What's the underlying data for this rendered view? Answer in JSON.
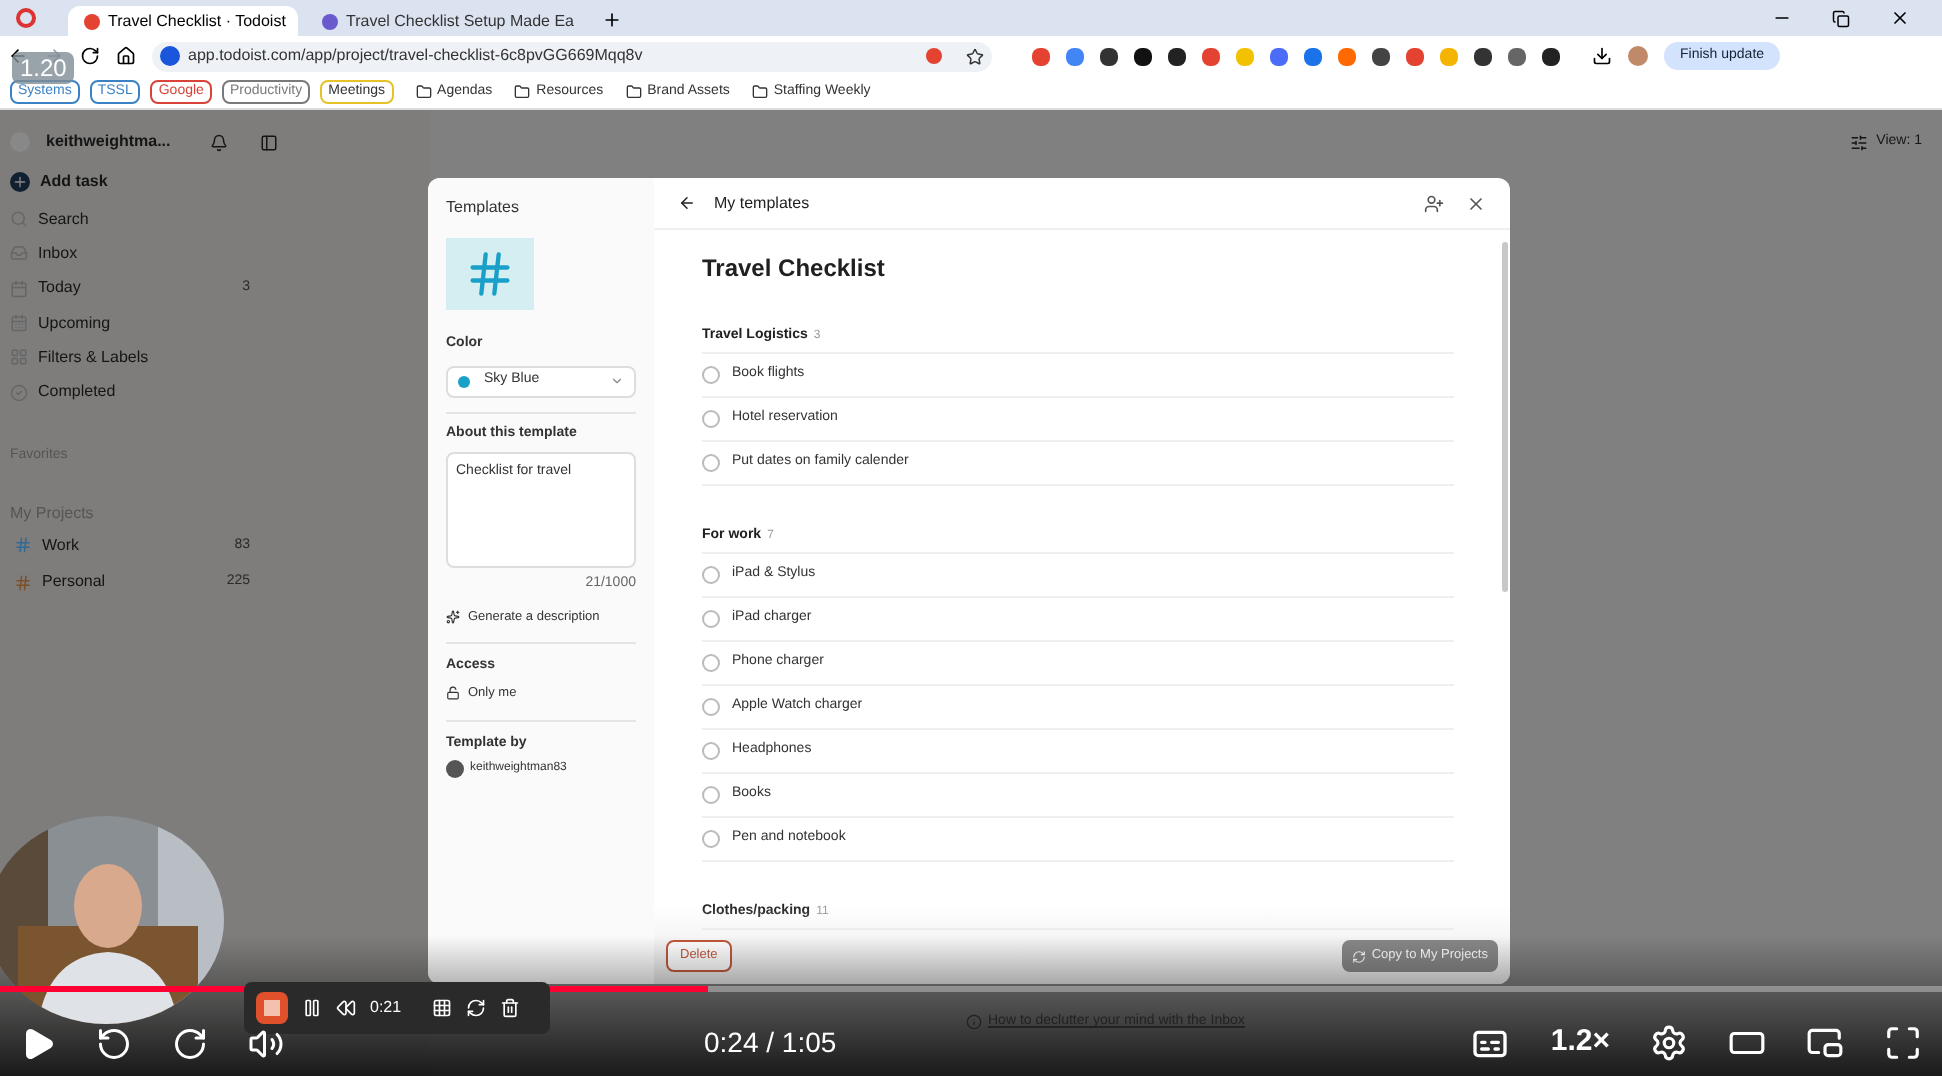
{
  "browser": {
    "tabs": [
      {
        "title": "Travel Checklist · Todoist",
        "selected": true
      },
      {
        "title": "Travel Checklist Setup Made Ea",
        "selected": false
      }
    ],
    "url": "app.todoist.com/app/project/travel-checklist-6c8pvGG669Mqq8v",
    "finish_update": "Finish update",
    "bookmarks": [
      {
        "kind": "tag",
        "label": "Systems",
        "color": "#3b82c4"
      },
      {
        "kind": "tag",
        "label": "TSSL",
        "color": "#3b82c4"
      },
      {
        "kind": "tag",
        "label": "Google",
        "color": "#d9443a"
      },
      {
        "kind": "tag",
        "label": "Productivity",
        "color": "#7a7a7a"
      },
      {
        "kind": "tag",
        "label": "Meetings",
        "color": "#e6c229"
      },
      {
        "kind": "folder",
        "label": "Agendas"
      },
      {
        "kind": "folder",
        "label": "Resources"
      },
      {
        "kind": "folder",
        "label": "Brand Assets"
      },
      {
        "kind": "folder",
        "label": "Staffing Weekly"
      }
    ]
  },
  "video": {
    "speed_badge": "1.20",
    "level": 0.365,
    "time": "0:24 / 1:05",
    "speed": "1.2×",
    "overlay_link": "How to declutter your mind with the Inbox"
  },
  "recorder": {
    "time": "0:21"
  },
  "sidebar": {
    "user": "keithweightma...",
    "add_task": "Add task",
    "items": [
      {
        "label": "Search"
      },
      {
        "label": "Inbox"
      },
      {
        "label": "Today",
        "count": "3"
      },
      {
        "label": "Upcoming"
      },
      {
        "label": "Filters & Labels"
      },
      {
        "label": "Completed"
      }
    ],
    "favorites": "Favorites",
    "my_projects": "My Projects",
    "projects": [
      {
        "name": "Work",
        "count": "83",
        "color": "#2f6a94"
      },
      {
        "name": "Personal",
        "count": "225",
        "color": "#7a5028"
      }
    ]
  },
  "view_button": "View: 1",
  "modal": {
    "panel_title": "Templates",
    "color_label": "Color",
    "color_value": "Sky Blue",
    "color": "#1aa0c8",
    "about_label": "About this template",
    "about_value": "Checklist for travel",
    "char_count": "21/1000",
    "generate": "Generate a description",
    "access_label": "Access",
    "access_value": "Only me",
    "author_label": "Template by",
    "author": "keithweightman83",
    "back_label": "My templates",
    "title": "Travel Checklist",
    "sections": [
      {
        "name": "Travel Logistics",
        "count": "3",
        "tasks": [
          {
            "text": "Book flights",
            "checked": false
          },
          {
            "text": "Hotel reservation",
            "checked": false
          },
          {
            "text": "Put dates on family calender",
            "checked": false
          }
        ]
      },
      {
        "name": "For work",
        "count": "7",
        "tasks": [
          {
            "text": "iPad & Stylus",
            "checked": false
          },
          {
            "text": "iPad charger",
            "checked": false
          },
          {
            "text": "Phone charger",
            "checked": false
          },
          {
            "text": "Apple Watch charger",
            "checked": false
          },
          {
            "text": "Headphones",
            "checked": false
          },
          {
            "text": "Books",
            "checked": false
          },
          {
            "text": "Pen and notebook",
            "checked": false
          }
        ]
      },
      {
        "name": "Clothes/packing",
        "count": "11"
      }
    ],
    "delete": "Delete",
    "copy": "Copy to My Projects"
  }
}
